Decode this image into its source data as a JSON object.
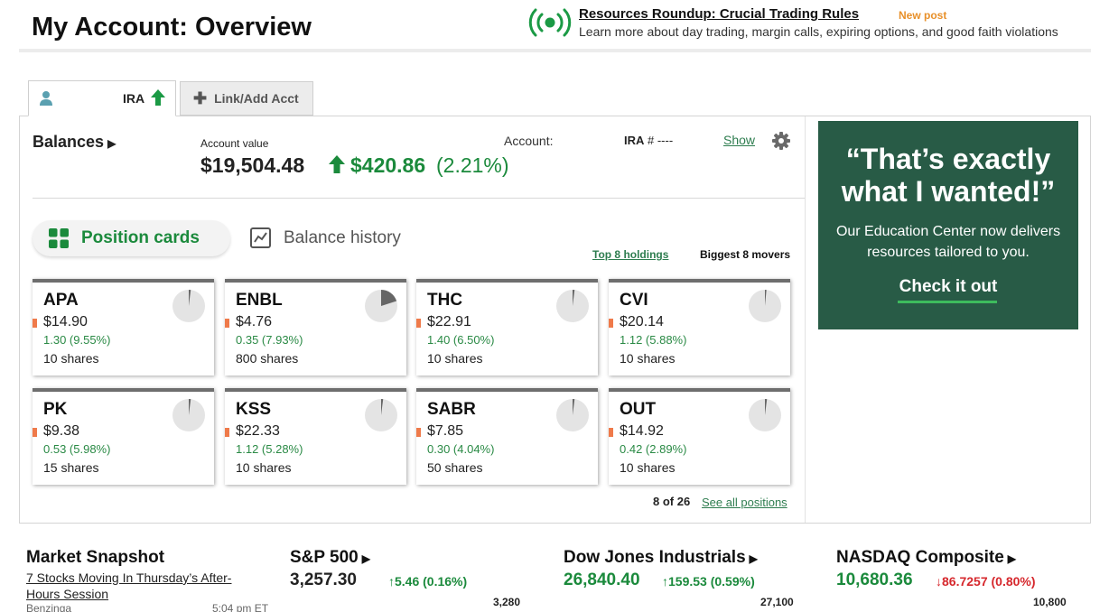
{
  "header": {
    "title": "My Account: Overview",
    "promo": {
      "link": "Resources Roundup: Crucial Trading Rules",
      "badge": "New post",
      "subtitle": "Learn more about day trading, margin calls, expiring options, and good faith violations"
    }
  },
  "tabs": {
    "ira": "IRA",
    "link_add": "Link/Add Acct"
  },
  "balances": {
    "title": "Balances",
    "account_value_label": "Account value",
    "account_value": "$19,504.48",
    "gain": "$420.86",
    "gain_pct": "(2.21%)",
    "account_label": "Account:",
    "account_type": "IRA",
    "account_number": "# ----",
    "show_link": "Show"
  },
  "view_toggle": {
    "position_cards": "Position cards",
    "balance_history": "Balance history",
    "top_holdings": "Top 8 holdings",
    "biggest_movers": "Biggest 8 movers"
  },
  "positions": [
    {
      "symbol": "APA",
      "price": "$14.90",
      "change": "1.30 (9.55%)",
      "shares": "10 shares",
      "portfolio_fraction": 0.02
    },
    {
      "symbol": "ENBL",
      "price": "$4.76",
      "change": "0.35 (7.93%)",
      "shares": "800 shares",
      "portfolio_fraction": 0.2
    },
    {
      "symbol": "THC",
      "price": "$22.91",
      "change": "1.40 (6.50%)",
      "shares": "10 shares",
      "portfolio_fraction": 0.02
    },
    {
      "symbol": "CVI",
      "price": "$20.14",
      "change": "1.12 (5.88%)",
      "shares": "10 shares",
      "portfolio_fraction": 0.015
    },
    {
      "symbol": "PK",
      "price": "$9.38",
      "change": "0.53 (5.98%)",
      "shares": "15 shares",
      "portfolio_fraction": 0.02
    },
    {
      "symbol": "KSS",
      "price": "$22.33",
      "change": "1.12 (5.28%)",
      "shares": "10 shares",
      "portfolio_fraction": 0.02
    },
    {
      "symbol": "SABR",
      "price": "$7.85",
      "change": "0.30 (4.04%)",
      "shares": "50 shares",
      "portfolio_fraction": 0.02
    },
    {
      "symbol": "OUT",
      "price": "$14.92",
      "change": "0.42 (2.89%)",
      "shares": "10 shares",
      "portfolio_fraction": 0.02
    }
  ],
  "positions_footer": {
    "count": "8 of 26",
    "see_all": "See all positions"
  },
  "ad": {
    "headline": "“That’s exactly what I wanted!”",
    "body": "Our Education Center now delivers resources tailored to you.",
    "cta": "Check it out",
    "bg_color": "#285b46"
  },
  "market_snapshot": {
    "title": "Market Snapshot",
    "story": "7 Stocks Moving In Thursday’s After-Hours Session",
    "source": "Benzinga",
    "time": "5:04 pm ET"
  },
  "indices": [
    {
      "name": "S&P 500",
      "value": "3,257.30",
      "change": "5.46 (0.16%)",
      "direction": "up",
      "axis_top": "3,280"
    },
    {
      "name": "Dow Jones Industrials",
      "value": "26,840.40",
      "change": "159.53 (0.59%)",
      "direction": "up",
      "axis_top": "27,100"
    },
    {
      "name": "NASDAQ Composite",
      "value": "10,680.36",
      "change": "86.7257 (0.80%)",
      "direction": "down",
      "axis_top": "10,800"
    }
  ]
}
